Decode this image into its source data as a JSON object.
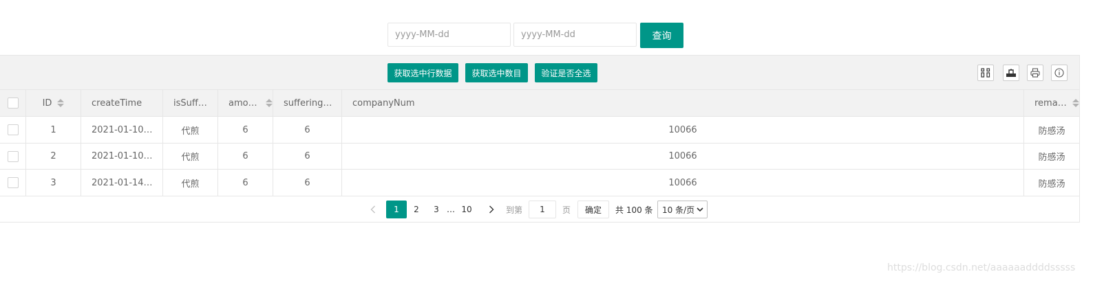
{
  "search": {
    "start_placeholder": "yyyy-MM-dd",
    "end_placeholder": "yyyy-MM-dd",
    "query_label": "查询"
  },
  "toolbar": {
    "buttons": [
      "获取选中行数据",
      "获取选中数目",
      "验证是否全选"
    ],
    "icons": [
      "columns-filter-icon",
      "export-icon",
      "print-icon",
      "info-icon"
    ]
  },
  "table": {
    "columns": [
      "ID",
      "createTime",
      "isSuff…",
      "amou…",
      "suffering…",
      "companyNum",
      "remar…"
    ],
    "rows": [
      {
        "id": "1",
        "createTime": "2021-01-10…",
        "isSuff": "代煎",
        "amount": "6",
        "suffering": "6",
        "companyNum": "10066",
        "remark": "防感汤"
      },
      {
        "id": "2",
        "createTime": "2021-01-10…",
        "isSuff": "代煎",
        "amount": "6",
        "suffering": "6",
        "companyNum": "10066",
        "remark": "防感汤"
      },
      {
        "id": "3",
        "createTime": "2021-01-14…",
        "isSuff": "代煎",
        "amount": "6",
        "suffering": "6",
        "companyNum": "10066",
        "remark": "防感汤"
      }
    ]
  },
  "pagination": {
    "pages": [
      "1",
      "2",
      "3"
    ],
    "ellipsis": "…",
    "last_page": "10",
    "current": "1",
    "goto_label": "到第",
    "goto_value": "1",
    "page_unit": "页",
    "confirm_label": "确定",
    "total_label": "共 100 条",
    "page_size_label": "10 条/页"
  },
  "watermark": "https://blog.csdn.net/aaaaaaddddsssss",
  "colors": {
    "accent": "#009688",
    "header_bg": "#f2f2f2",
    "border": "#e6e6e6"
  }
}
